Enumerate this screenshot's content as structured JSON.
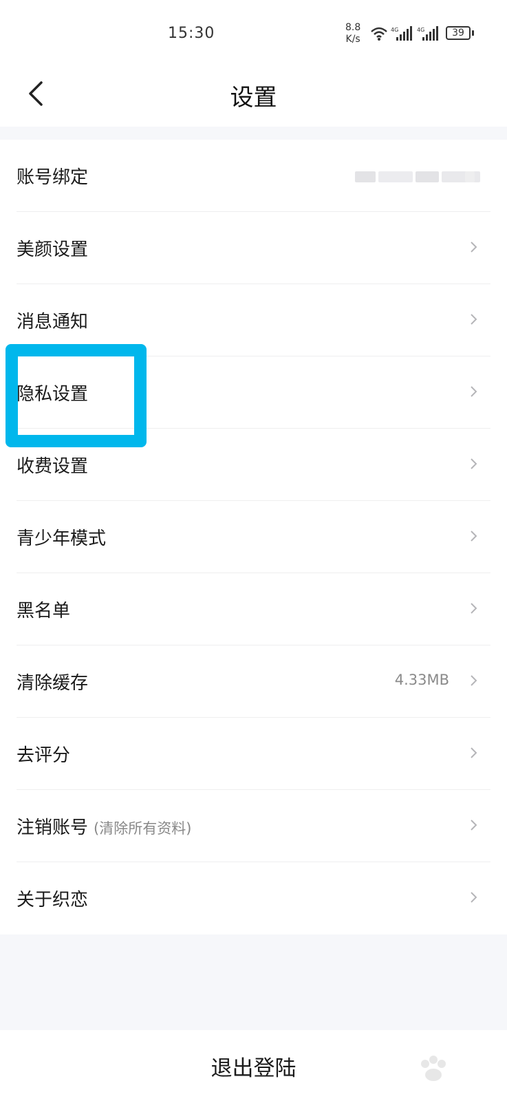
{
  "status_bar": {
    "time": "15:30",
    "net_speed_value": "8.8",
    "net_speed_unit": "K/s",
    "battery": "39"
  },
  "header": {
    "title": "设置"
  },
  "settings": {
    "items": [
      {
        "label": "账号绑定",
        "value": "",
        "sub": ""
      },
      {
        "label": "美颜设置",
        "value": "",
        "sub": ""
      },
      {
        "label": "消息通知",
        "value": "",
        "sub": ""
      },
      {
        "label": "隐私设置",
        "value": "",
        "sub": ""
      },
      {
        "label": "收费设置",
        "value": "",
        "sub": ""
      },
      {
        "label": "青少年模式",
        "value": "",
        "sub": ""
      },
      {
        "label": "黑名单",
        "value": "",
        "sub": ""
      },
      {
        "label": "清除缓存",
        "value": "4.33MB",
        "sub": ""
      },
      {
        "label": "去评分",
        "value": "",
        "sub": ""
      },
      {
        "label": "注销账号",
        "value": "",
        "sub": "(清除所有资料)"
      },
      {
        "label": "关于织恋",
        "value": "",
        "sub": ""
      }
    ]
  },
  "footer": {
    "logout_label": "退出登陆"
  },
  "colors": {
    "highlight": "#00b7ec",
    "background": "#f6f7fa"
  }
}
